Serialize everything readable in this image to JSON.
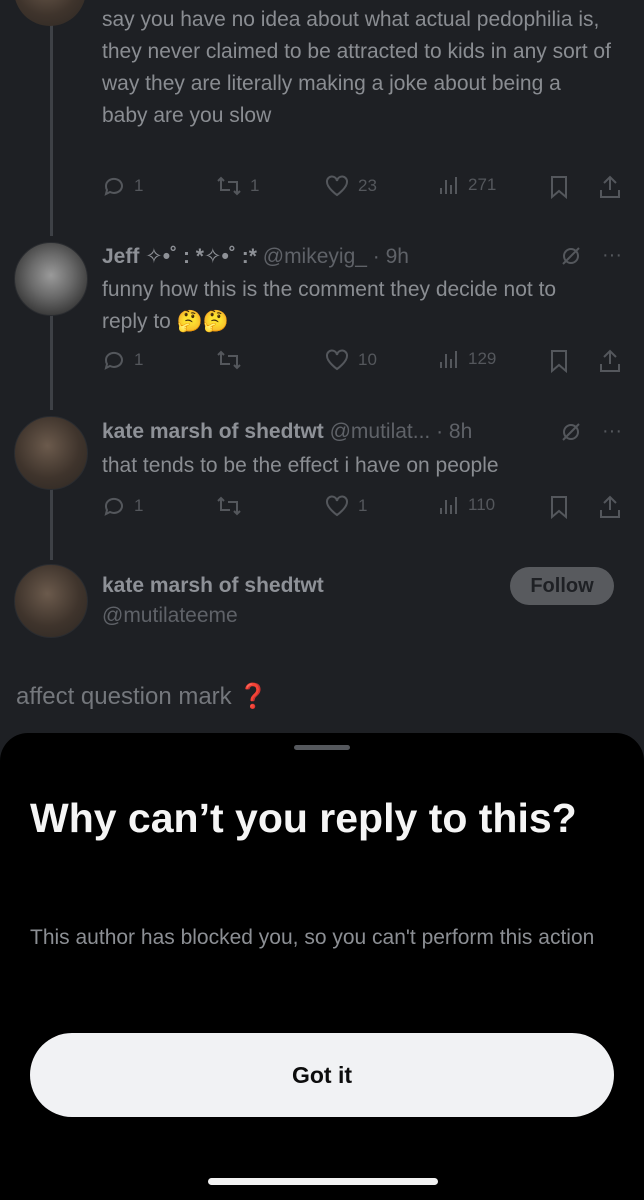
{
  "tweets": [
    {
      "text": "say you have no idea about what actual pedophilia is, they never claimed to be attracted to kids in any sort of way they are literally making a joke about being a baby are you slow",
      "stats": {
        "replies": "1",
        "retweets": "1",
        "likes": "23",
        "views": "271"
      }
    },
    {
      "name": "Jeff ✧•̩̩̥͙˚̩̥̩̥*̩̩͙✩*̩̩̥͙˚̩̥̩̥*̩̩͙‧͙",
      "name_plain": "Jeff ✧•˚ : *✧•˚ :*",
      "handle": "@mikeyig_",
      "time": "· 9h",
      "text": "funny how this is the comment they decide not to reply to 🤔🤔",
      "stats": {
        "replies": "1",
        "retweets": "",
        "likes": "10",
        "views": "129"
      }
    },
    {
      "name": "kate marsh of shedtwt",
      "handle": "@mutilat...",
      "time": "· 8h",
      "text": "that tends to be the effect i have on people",
      "stats": {
        "replies": "1",
        "retweets": "",
        "likes": "1",
        "views": "110"
      }
    }
  ],
  "reply_context": {
    "name": "kate marsh of shedtwt",
    "handle": "@mutilateeme",
    "follow_label": "Follow"
  },
  "composer_preview": {
    "text": "affect question mark",
    "emoji": "❓"
  },
  "sheet": {
    "title": "Why can’t you reply to this?",
    "description": "This author has blocked you, so you can't perform this action",
    "button_label": "Got it"
  },
  "icons": {
    "reply": "reply-icon",
    "retweet": "retweet-icon",
    "like": "heart-icon",
    "views": "views-icon",
    "bookmark": "bookmark-icon",
    "share": "share-icon",
    "grok": "grok-icon",
    "more": "more-icon"
  }
}
